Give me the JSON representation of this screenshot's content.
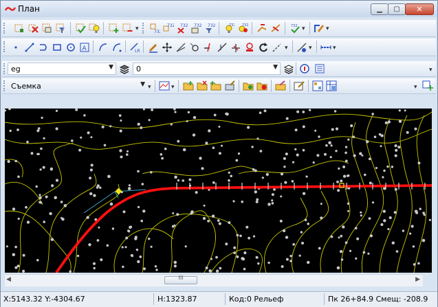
{
  "window": {
    "title": "План"
  },
  "layer_combo": {
    "value": "eg"
  },
  "line_combo": {
    "value": "0"
  },
  "survey_combo": {
    "value": "Съемка"
  },
  "scrollbar": {
    "thumb_grip": "III"
  },
  "status": {
    "coords": "X:5143.32  Y:-4304.67",
    "height": "H:1323.87",
    "code": "Код:0 Рельеф",
    "station": "Пк 26+84.9  Смещ: -208.9"
  },
  "colors": {
    "road": "#ff1010",
    "contours": "#c8c800",
    "points": "#c8c8c8",
    "canvas_bg": "#000000"
  },
  "icons": {
    "toolbar1": [
      "layers-edit-icon",
      "delete-layer-icon",
      "layer-properties-icon",
      "layer-filter-icon",
      "check-layer-icon",
      "bulb-icon",
      "add-layer-icon",
      "remove-layer-icon",
      "axis-732-icon",
      "axis-732-delete-icon",
      "axis-732-edit-icon",
      "axis-732-filter-icon",
      "point-bulb-icon",
      "point-filter-icon",
      "break-line-icon",
      "slash-icon",
      "check-points-icon",
      "draw-edit-icon"
    ],
    "toolbar2": [
      "point-icon",
      "segment-icon",
      "polyline-icon",
      "rectangle-icon",
      "circle-icon",
      "text-icon",
      "arc-icon",
      "arc2-icon",
      "lr-line-icon",
      "pen-icon",
      "move-icon",
      "angle-icon",
      "link-icon",
      "trim-icon",
      "extend-icon",
      "cross-icon",
      "stamp-icon",
      "rotate-icon",
      "spline-icon",
      "pattern-icon",
      "dimension-icon"
    ],
    "toolbar4": [
      "profile-icon",
      "folder-add-icon",
      "folder-remove-icon",
      "folder-star-icon",
      "folder-edit-icon",
      "folder-open-icon",
      "folder-delete-icon",
      "folder-paint-icon",
      "form-edit-icon",
      "grid-icon",
      "table-icon",
      "add-point-icon"
    ]
  }
}
